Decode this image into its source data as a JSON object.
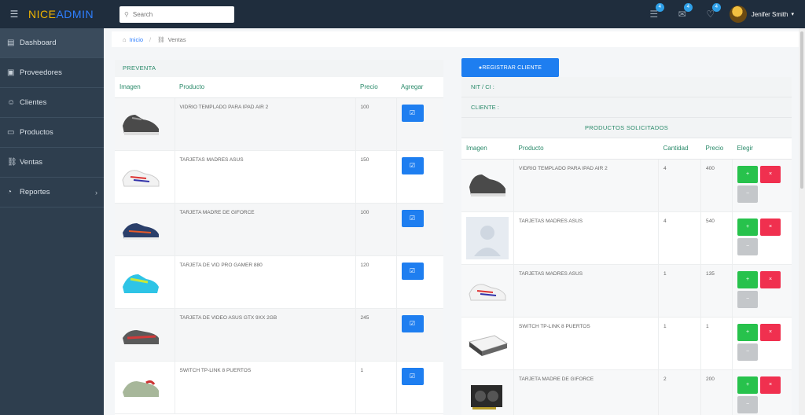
{
  "header": {
    "logo_part1": "NICE",
    "logo_part2": "ADMIN",
    "search_placeholder": "Search",
    "badges": [
      "4",
      "4",
      "4"
    ],
    "user_name": "Jenifer Smith"
  },
  "sidebar": {
    "items": [
      {
        "label": "Dashboard",
        "icon": "dashboard-icon"
      },
      {
        "label": "Proveedores",
        "icon": "truck-icon"
      },
      {
        "label": "Clientes",
        "icon": "users-icon"
      },
      {
        "label": "Productos",
        "icon": "box-icon"
      },
      {
        "label": "Ventas",
        "icon": "cart-icon"
      },
      {
        "label": "Reportes",
        "icon": "pie-chart-icon"
      }
    ]
  },
  "breadcrumb": {
    "home": "Inicio",
    "current": "Ventas"
  },
  "preventa": {
    "title": "PREVENTA",
    "columns": [
      "Imagen",
      "Producto",
      "Precio",
      "Agregar"
    ],
    "rows": [
      {
        "product": "VIDRIO TEMPLADO PARA IPAD AIR 2",
        "price": "100",
        "image": "shoe-gray"
      },
      {
        "product": "TARJETAS MADRES ASUS",
        "price": "150",
        "image": "shoe-white"
      },
      {
        "product": "TARJETA MADRE DE GIFORCE",
        "price": "100",
        "image": "shoe-navy"
      },
      {
        "product": "TARJETA DE VID PRO GAMER 880",
        "price": "120",
        "image": "shoe-cyan"
      },
      {
        "product": "TARJETA DE VIDEO ASUS GTX 9XX 2GB",
        "price": "245",
        "image": "shoe-red"
      },
      {
        "product": "SWITCH TP-LINK 8 PUERTOS",
        "price": "1",
        "image": "shoe-sage"
      }
    ]
  },
  "cliente": {
    "register_button": "REGISTRAR CLIENTE",
    "nit_label": "NIT / CI :",
    "cliente_label": "CLIENTE :"
  },
  "solicitados": {
    "title": "PRODUCTOS SOLICITADOS",
    "columns": [
      "Imagen",
      "Producto",
      "Cantidad",
      "Precio",
      "Elegir"
    ],
    "rows": [
      {
        "product": "VIDRIO TEMPLADO PARA IPAD AIR 2",
        "qty": "4",
        "price": "400",
        "image": "shoe-gray"
      },
      {
        "product": "TARJETAS MADRES ASUS",
        "qty": "4",
        "price": "540",
        "image": "placeholder"
      },
      {
        "product": "TARJETAS MADRES ASUS",
        "qty": "1",
        "price": "135",
        "image": "shoe-white"
      },
      {
        "product": "SWITCH TP-LINK 8 PUERTOS",
        "qty": "1",
        "price": "1",
        "image": "switch"
      },
      {
        "product": "TARJETA MADRE DE GIFORCE",
        "qty": "2",
        "price": "200",
        "image": "gpu"
      }
    ]
  },
  "colors": {
    "topbar": "#1f2d3d",
    "sidebar": "#2e3e4e",
    "primary": "#1e7ef0",
    "success": "#27c24c",
    "danger": "#f0304f",
    "heading_green": "#2a8a6a"
  }
}
